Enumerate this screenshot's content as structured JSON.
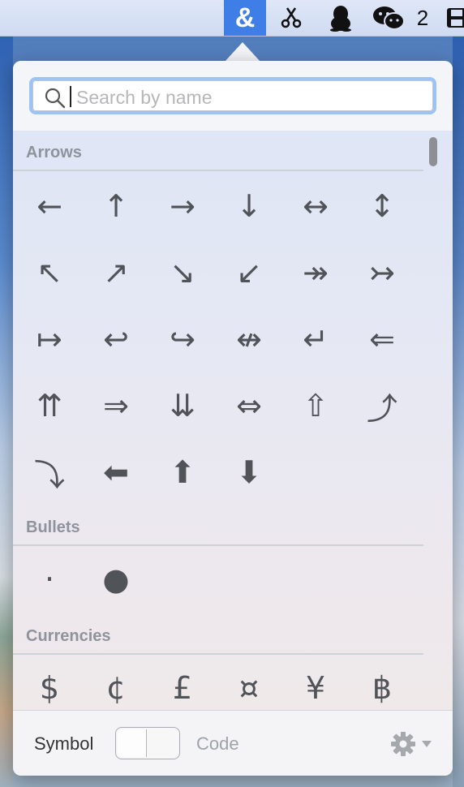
{
  "menubar": {
    "app_icon_glyph": "&",
    "notification_count": "2",
    "icons": [
      "ampersand-icon",
      "scissors-icon",
      "penguin-icon",
      "chat-icon",
      "disk-icon"
    ]
  },
  "search": {
    "placeholder": "Search by name",
    "value": ""
  },
  "sections": {
    "arrows": {
      "title": "Arrows",
      "symbols": [
        "←",
        "↑",
        "→",
        "↓",
        "↔",
        "↕",
        "↖",
        "↗",
        "↘",
        "↙",
        "↠",
        "↣",
        "↦",
        "↩",
        "↪",
        "↮",
        "↵",
        "⇐",
        "⇈",
        "⇒",
        "⇊",
        "⇔",
        "⇧",
        "⤴",
        "⤵",
        "⬅",
        "⬆",
        "⬇"
      ]
    },
    "bullets": {
      "title": "Bullets",
      "symbols": [
        "·",
        "●"
      ]
    },
    "currencies": {
      "title": "Currencies",
      "symbols": [
        "$",
        "¢",
        "£",
        "¤",
        "¥",
        "฿"
      ]
    }
  },
  "footer": {
    "symbol_label": "Symbol",
    "code_label": "Code",
    "mode": "Symbol"
  },
  "colors": {
    "accent": "#3f7ee6",
    "focus_ring": "#9cc3f3",
    "symbol": "#505358",
    "section_title": "#8f939c"
  }
}
